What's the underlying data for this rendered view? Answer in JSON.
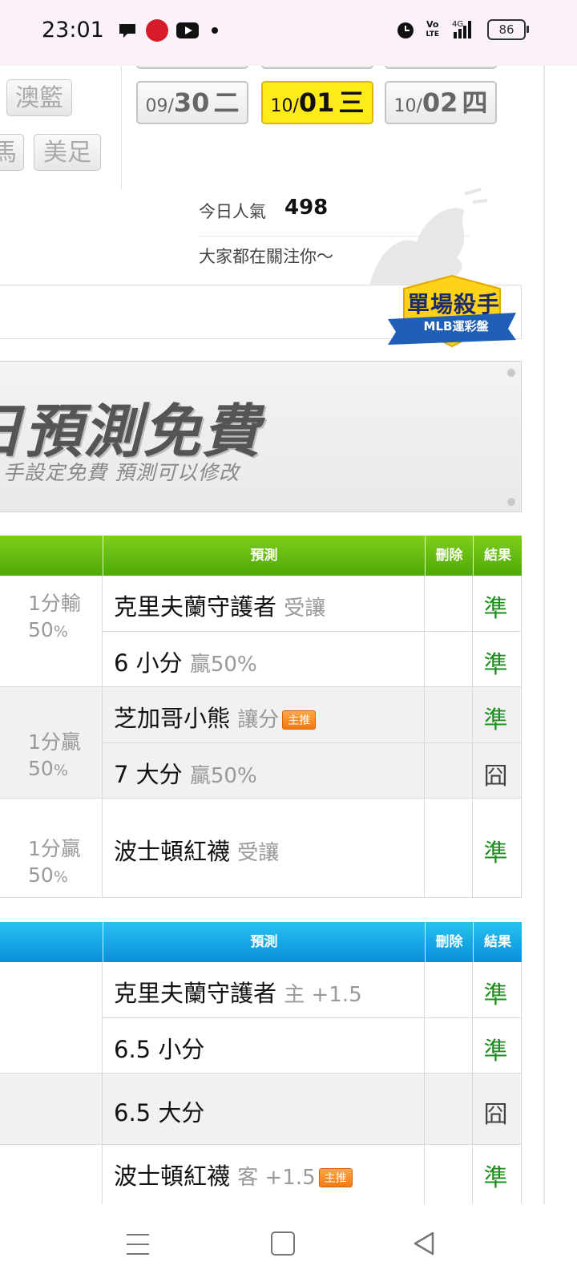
{
  "status_bar": {
    "time": "23:01",
    "battery": "86",
    "icons": [
      "chat-bubble-icon",
      "app-icon",
      "youtube-icon",
      "dot-icon",
      "alarm-icon",
      "volte-icon",
      "signal-4g-icon",
      "battery-icon"
    ],
    "volte_line1": "Vo",
    "volte_line2": "LTE",
    "net": "4G"
  },
  "categories": {
    "aus_basketball": "澳籃",
    "horse": "馬",
    "us_football": "美足"
  },
  "dates": [
    {
      "month": "09/",
      "day": "30",
      "weekday": "二",
      "active": false
    },
    {
      "month": "10/",
      "day": "01",
      "weekday": "三",
      "active": true
    },
    {
      "month": "10/",
      "day": "02",
      "weekday": "四",
      "active": false
    }
  ],
  "popularity": {
    "label": "今日人氣",
    "count": "498",
    "follow_text": "大家都在關注你～"
  },
  "badge": {
    "title": "單場殺手",
    "subtitle": "MLB運彩盤"
  },
  "banner": {
    "main": "日預測免費",
    "sub": "手設定免費  預測可以修改"
  },
  "table1": {
    "headers": {
      "prediction": "預測",
      "delete": "刪除",
      "result": "結果"
    },
    "rows": [
      {
        "team": "克里夫蘭守護者",
        "note": "受讓",
        "tag": "",
        "result": "準"
      },
      {
        "team": "6 小分",
        "note": "贏50%",
        "tag": "",
        "result": "準"
      },
      {
        "team": "芝加哥小熊",
        "note": "讓分",
        "tag": "主推",
        "result": "準"
      },
      {
        "team": "7 大分",
        "note": "贏50%",
        "tag": "",
        "result": "囧"
      },
      {
        "team": "波士頓紅襪",
        "note": "受讓",
        "tag": "",
        "result": "準"
      }
    ],
    "left_labels": [
      {
        "line1": "1分輸",
        "line2": "50",
        "pct": "%"
      },
      {
        "line1": "1分贏",
        "line2": "50",
        "pct": "%"
      },
      {
        "line1": "1分贏",
        "line2": "50",
        "pct": "%"
      }
    ]
  },
  "table2": {
    "headers": {
      "prediction": "預測",
      "delete": "刪除",
      "result": "結果"
    },
    "rows": [
      {
        "team": "克里夫蘭守護者",
        "note": "主 +1.5",
        "tag": "",
        "result": "準"
      },
      {
        "team": "6.5 小分",
        "note": "",
        "tag": "",
        "result": "準"
      },
      {
        "team": "6.5 大分",
        "note": "",
        "tag": "",
        "result": "囧"
      },
      {
        "team": "波士頓紅襪",
        "note": "客 +1.5",
        "tag": "主推",
        "result": "準"
      }
    ]
  },
  "colors": {
    "green_header": "#5cb80e",
    "blue_header": "#14a6e6",
    "active_date": "#ffeb1a",
    "hit": "#1e8f1e",
    "tag": "#f28a22"
  },
  "nav": {
    "icons": [
      "menu-icon",
      "home-icon",
      "back-icon"
    ]
  }
}
